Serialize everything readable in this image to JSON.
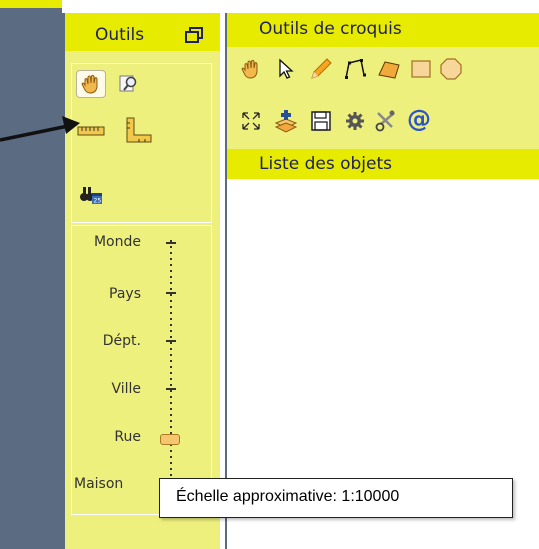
{
  "outils": {
    "title": "Outils",
    "scale_levels": [
      "Monde",
      "Pays",
      "Dépt.",
      "Ville",
      "Rue",
      "Maison"
    ],
    "scale_value": 0.78
  },
  "sketch": {
    "title": "Outils de croquis"
  },
  "objects": {
    "title": "Liste des objets"
  },
  "tooltip": {
    "text": "Échelle approximative: 1:10000"
  },
  "icons": {
    "pan": "hand-icon",
    "zoom": "zoom-icon",
    "measure_distance": "ruler-icon",
    "measure_area": "area-ruler-icon",
    "directory": "binoculars-calendar-icon",
    "sketch_tools": [
      "hand-icon",
      "pointer-icon",
      "pencil-icon",
      "polyline-icon",
      "polygon-icon",
      "rectangle-icon",
      "octagon-icon",
      "expand-icon",
      "add-layer-icon",
      "save-icon",
      "settings-icon",
      "scissors-icon",
      "at-icon"
    ]
  },
  "colors": {
    "header": "#e6eb00",
    "panel": "#eef07d",
    "frame": "#5b6b82",
    "title_text": "#1f1f60"
  }
}
